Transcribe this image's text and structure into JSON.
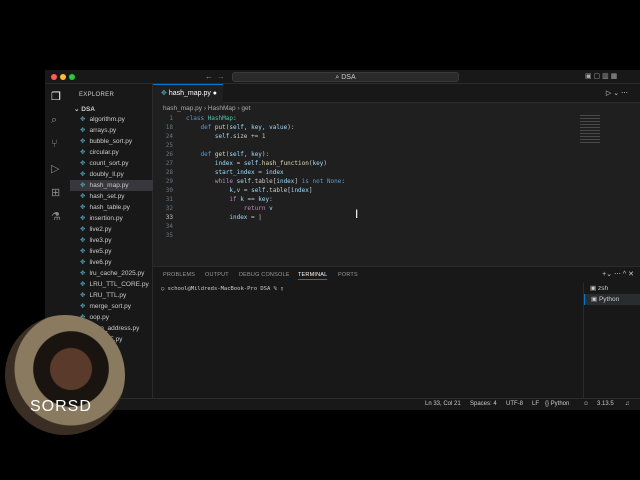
{
  "title": "DSA",
  "explorer": {
    "header": "EXPLORER",
    "root": "DSA",
    "badge": "1",
    "files": [
      "algorithm.py",
      "arrays.py",
      "bubble_sort.py",
      "circular.py",
      "count_sort.py",
      "doubly_ll.py",
      "hash_map.py",
      "hash_set.py",
      "hash_table.py",
      "insertion.py",
      "live2.py",
      "live3.py",
      "live5.py",
      "live6.py",
      "lru_cache_2025.py",
      "LRU_TTL_CORE.py",
      "LRU_TTL.py",
      "merge_sort.py",
      "oop.py",
      "open_address.py",
      "...CORE.py"
    ],
    "selected": "hash_map.py"
  },
  "tab": {
    "label": "hash_map.py"
  },
  "breadcrumb": [
    "hash_map.py",
    "HashMap",
    "get"
  ],
  "code": [
    {
      "n": "1",
      "html": "<span class='kw'>class</span> <span class='cl'>HashMap</span>:"
    },
    {
      "n": "18",
      "html": "    <span class='kw'>def</span> <span class='fn'>put</span>(<span class='vr'>self</span>, <span class='vr'>key</span>, <span class='vr'>value</span>):"
    },
    {
      "n": "24",
      "html": "        <span class='vr'>self</span>.size += 1"
    },
    {
      "n": "25",
      "html": ""
    },
    {
      "n": "26",
      "html": "    <span class='kw'>def</span> <span class='fn'>get</span>(<span class='vr'>self</span>, <span class='vr'>key</span>):"
    },
    {
      "n": "27",
      "html": "        <span class='vr'>index</span> = <span class='vr'>self</span>.<span class='fn'>hash_function</span>(<span class='vr'>key</span>)"
    },
    {
      "n": "28",
      "html": "        <span class='vr'>start_index</span> = <span class='vr'>index</span>"
    },
    {
      "n": "29",
      "html": "        <span class='pk'>while</span> <span class='vr'>self</span>.table[<span class='vr'>index</span>] <span class='kw'>is not None</span>:"
    },
    {
      "n": "30",
      "html": "            <span class='vr'>k</span>,<span class='vr'>v</span> = <span class='vr'>self</span>.table[<span class='vr'>index</span>]"
    },
    {
      "n": "31",
      "html": "            <span class='pk'>if</span> <span class='vr'>k</span> == <span class='vr'>key</span>:"
    },
    {
      "n": "32",
      "html": "                <span class='pk'>return</span> <span class='vr'>v</span>"
    },
    {
      "n": "33",
      "html": "            <span class='vr'>index</span> = |"
    },
    {
      "n": "34",
      "html": ""
    },
    {
      "n": "35",
      "html": ""
    }
  ],
  "panel": {
    "tabs": [
      "PROBLEMS",
      "OUTPUT",
      "DEBUG CONSOLE",
      "TERMINAL",
      "PORTS"
    ],
    "active": "TERMINAL",
    "prompt": "school@Mildreds-MacBook-Pro DSA % ",
    "terminals": [
      "zsh",
      "Python"
    ]
  },
  "status": {
    "position": "Ln 33, Col 21",
    "spaces": "Spaces: 4",
    "encoding": "UTF-8",
    "eol": "LF",
    "language": "{} Python",
    "version": "3.13.5"
  },
  "webcam": {
    "caption": "SORSD"
  }
}
